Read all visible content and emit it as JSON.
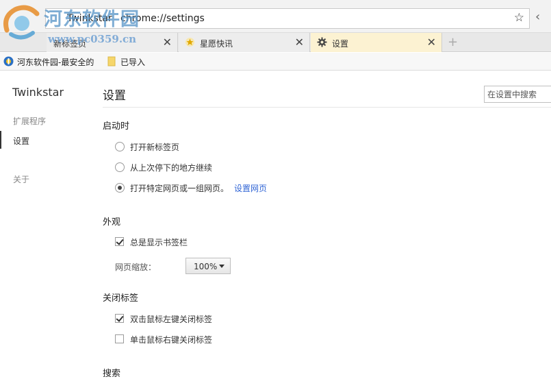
{
  "watermark": {
    "title": "河东软件园",
    "url": "www.pc0359.cn"
  },
  "address_bar": {
    "brand": "Twinkstar",
    "url": "chrome://settings",
    "star_icon": "star-outline-icon"
  },
  "tabs": [
    {
      "label": "新标签页",
      "icon": "blank-page-icon",
      "active": false
    },
    {
      "label": "星愿快讯",
      "icon": "star-emblem-icon",
      "active": false
    },
    {
      "label": "设置",
      "icon": "gear-icon",
      "active": true
    }
  ],
  "bookmarks": [
    {
      "label": "河东软件园-最安全的",
      "icon": "site-favicon"
    },
    {
      "label": "已导入",
      "icon": "folder-icon"
    }
  ],
  "sidebar": {
    "brand": "Twinkstar",
    "items": [
      {
        "label": "扩展程序",
        "active": false
      },
      {
        "label": "设置",
        "active": true
      },
      {
        "label": "关于",
        "active": false
      }
    ]
  },
  "main": {
    "title": "设置",
    "search_placeholder": "在设置中搜索",
    "startup": {
      "title": "启动时",
      "options": [
        {
          "label": "打开新标签页",
          "selected": false
        },
        {
          "label": "从上次停下的地方继续",
          "selected": false
        },
        {
          "label": "打开特定网页或一组网页。",
          "selected": true,
          "link": "设置网页"
        }
      ]
    },
    "appearance": {
      "title": "外观",
      "show_bookmarks_bar": {
        "label": "总是显示书签栏",
        "checked": true
      },
      "zoom_label": "网页缩放：",
      "zoom_value": "100%"
    },
    "close_tab": {
      "title": "关闭标签",
      "options": [
        {
          "label": "双击鼠标左键关闭标签",
          "checked": true
        },
        {
          "label": "单击鼠标右键关闭标签",
          "checked": false
        }
      ]
    },
    "search": {
      "title": "搜索"
    }
  },
  "colors": {
    "active_tab": "#fcf2d2",
    "link": "#3367d6"
  }
}
